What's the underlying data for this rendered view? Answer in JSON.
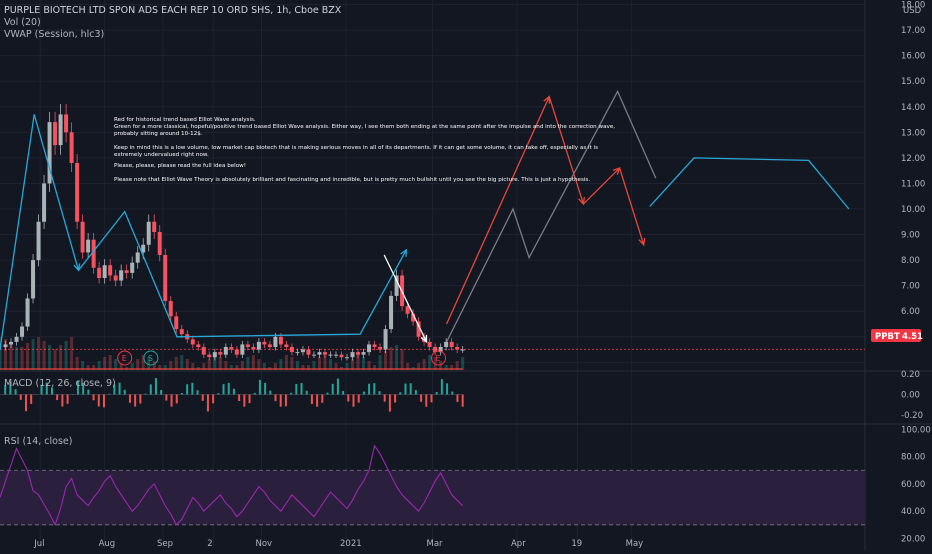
{
  "header": {
    "title": "PURPLE BIOTECH LTD SPON ADS EACH REP 10 ORD SHS, 1h, Cboe BZX",
    "vol_label": "Vol (20)",
    "vwap_label": "VWAP (Session, hlc3)",
    "currency": "USD"
  },
  "annotation": {
    "lines": [
      "Red for historical trend based Elliot Wave analysis.",
      "Green for a more classical, hopeful/positive trend based Elliot Wave analysis. Either way, I see them both ending at the same point after the impulse and into the correction wave,",
      "probably sitting around 10-12$.",
      "",
      "Keep in mind this is a low volume, low market cap biotech that is making serious moves in all of its departments. If it can get some volume, it can take off, especially as it is",
      "extremely undervalued right now.",
      "",
      "Please, please, please read the full idea below!",
      "",
      "Please note that Elliot Wave Theory is absolutely brilliant and fascinating and incredible, but is pretty much bullshit until you see the big picture. This is just a hypothesis."
    ]
  },
  "markers": {
    "e_label": "E",
    "s_label": "S"
  },
  "price_tag": {
    "symbol": "PPBT",
    "value": "4.51"
  },
  "panes": {
    "macd_label": "MACD (12, 26, close, 9)",
    "rsi_label": "RSI (14, close)"
  },
  "colors": {
    "background": "#131722",
    "wave_blue": "#29a8d8",
    "wave_red": "#e8473c",
    "wave_gray": "#787b86",
    "rsi_line": "#9c27b0",
    "rsi_band": "#2a1f3d",
    "price_tag": "#f23645",
    "candles": "#a9b4b8"
  },
  "chart_data": [
    {
      "type": "line",
      "pane": "price",
      "y_ticks": [
        4,
        5,
        6,
        7,
        8,
        9,
        10,
        11,
        12,
        13,
        14,
        15,
        16,
        17,
        18
      ],
      "y_tick_labels": [
        "",
        "5.00",
        "6.00",
        "7.00",
        "8.00",
        "9.00",
        "10.00",
        "11.00",
        "12.00",
        "13.00",
        "14.00",
        "15.00",
        "16.00",
        "17.00",
        "18.00"
      ],
      "x_tick_labels": [
        "Jul",
        "Aug",
        "Sep",
        "2",
        "Nov",
        "2021",
        "Mar",
        "Apr",
        "19",
        "May"
      ],
      "ylim": [
        3.7,
        18.1
      ],
      "last_price": 4.51,
      "price_path": [
        4.6,
        4.7,
        4.8,
        5,
        5.4,
        6.5,
        8,
        9.5,
        11,
        13.4,
        12.5,
        13.7,
        13,
        11.8,
        9.5,
        8.3,
        8.8,
        7.7,
        7.3,
        7.8,
        7.4,
        7.2,
        7.6,
        7.5,
        7.9,
        8.3,
        8.6,
        9.5,
        9.1,
        8.2,
        6.4,
        5.8,
        5.3,
        5.1,
        4.9,
        4.7,
        4.6,
        4.3,
        4.2,
        4.4,
        4.3,
        4.6,
        4.5,
        4.3,
        4.7,
        4.6,
        4.5,
        4.8,
        4.7,
        4.6,
        5,
        4.7,
        4.6,
        4.4,
        4.4,
        4.5,
        4.3,
        4.3,
        4.4,
        4.3,
        4.3,
        4.3,
        4.2,
        4.2,
        4.4,
        4.3,
        4.4,
        4.7,
        4.6,
        4.5,
        5.3,
        6.6,
        7.4,
        6.2,
        5.9,
        5.6,
        5,
        4.8,
        4.6,
        4.4,
        4.6,
        4.8,
        4.6,
        4.5,
        4.5
      ],
      "wave_blue": [
        [
          0,
          4.5
        ],
        [
          17,
          13.7
        ],
        [
          39,
          7.6
        ],
        [
          62,
          9.9
        ],
        [
          88,
          5.0
        ],
        [
          179,
          5.1
        ],
        [
          202,
          8.4
        ],
        [
          223,
          4.8
        ]
      ],
      "wave_blue_projection": [
        [
          323,
          10.1
        ],
        [
          345,
          12.0
        ],
        [
          402,
          11.9
        ],
        [
          422,
          10.0
        ]
      ],
      "wave_red_history": [
        [
          191,
          8.2
        ],
        [
          212,
          4.8
        ]
      ],
      "wave_red_projection": [
        [
          222,
          5.5
        ],
        [
          273,
          14.4
        ],
        [
          290,
          10.2
        ],
        [
          308,
          11.6
        ],
        [
          320,
          8.6
        ]
      ],
      "wave_gray_projection": [
        [
          222,
          4.8
        ],
        [
          255,
          10.0
        ],
        [
          263,
          8.1
        ],
        [
          307,
          14.6
        ],
        [
          326,
          11.2
        ]
      ],
      "x_domain": [
        0,
        430
      ],
      "x_tick_positions": [
        20,
        52,
        81,
        106,
        130,
        172,
        215,
        257,
        287,
        314
      ],
      "elliott_markers": [
        {
          "label": "E",
          "x": 62
        },
        {
          "label": "S",
          "x": 75
        },
        {
          "label": "E",
          "x": 218
        }
      ]
    },
    {
      "type": "line",
      "pane": "macd",
      "title": "MACD (12, 26, close, 9)",
      "y_ticks": [
        0.2,
        0,
        -0.2
      ],
      "y_tick_labels": [
        "0.20",
        "0.00",
        "-0.20"
      ],
      "ylim": [
        -0.25,
        0.22
      ]
    },
    {
      "type": "line",
      "pane": "rsi",
      "title": "RSI (14, close)",
      "y_ticks": [
        100,
        80,
        60,
        40,
        20
      ],
      "y_tick_labels": [
        "100.00",
        "80.00",
        "60.00",
        "40.00",
        "20.00"
      ],
      "ylim": [
        13,
        101
      ],
      "bands": [
        30,
        70
      ],
      "values": [
        50,
        62,
        74,
        86,
        78,
        70,
        55,
        52,
        45,
        38,
        30,
        42,
        58,
        64,
        52,
        48,
        44,
        50,
        55,
        62,
        66,
        58,
        52,
        46,
        40,
        44,
        50,
        56,
        60,
        52,
        44,
        38,
        30,
        34,
        42,
        50,
        46,
        40,
        44,
        48,
        52,
        46,
        42,
        36,
        40,
        46,
        52,
        58,
        54,
        48,
        44,
        40,
        46,
        52,
        48,
        44,
        40,
        36,
        42,
        48,
        54,
        50,
        46,
        42,
        48,
        56,
        62,
        70,
        88,
        82,
        74,
        66,
        58,
        52,
        48,
        44,
        40,
        46,
        54,
        62,
        68,
        60,
        52,
        48,
        44
      ]
    }
  ]
}
